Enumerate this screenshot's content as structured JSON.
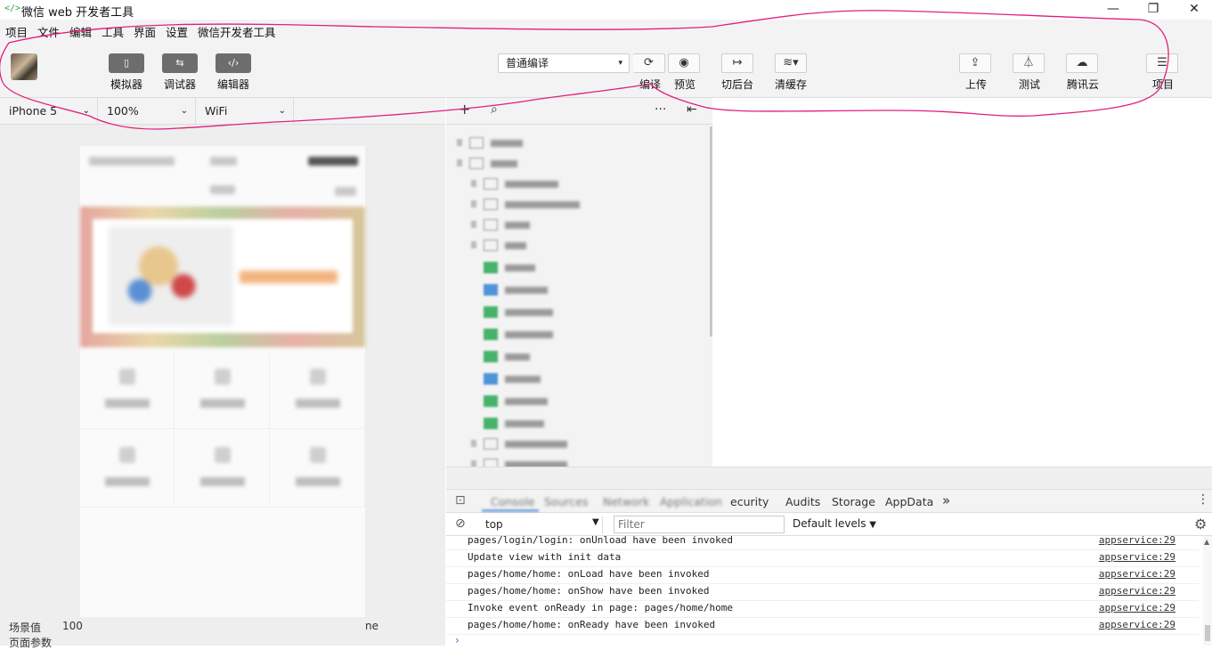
{
  "window": {
    "title": "微信 web 开发者工具",
    "icon": "code-brackets-icon",
    "minimize": "—",
    "maximize": "❐",
    "close": "✕"
  },
  "menubar": {
    "items": [
      "项目",
      "文件",
      "编辑",
      "工具",
      "界面",
      "设置",
      "微信开发者工具"
    ]
  },
  "toolbar": {
    "modes": [
      {
        "label": "模拟器",
        "icon": "phone-icon"
      },
      {
        "label": "调试器",
        "icon": "sliders-icon"
      },
      {
        "label": "编辑器",
        "icon": "code-icon"
      }
    ],
    "compile_select": "普通编译",
    "actions": [
      {
        "label": "编译",
        "icon": "refresh-icon"
      },
      {
        "label": "预览",
        "icon": "eye-icon"
      },
      {
        "label": "切后台",
        "icon": "switch-icon"
      },
      {
        "label": "清缓存",
        "icon": "layers-icon"
      }
    ],
    "right_actions": [
      {
        "label": "上传",
        "icon": "upload-icon"
      },
      {
        "label": "测试",
        "icon": "flask-icon"
      },
      {
        "label": "腾讯云",
        "icon": "cloud-icon"
      },
      {
        "label": "项目",
        "icon": "menu-icon"
      }
    ]
  },
  "devicebar": {
    "device": "iPhone 5",
    "zoom": "100%",
    "network": "WiFi"
  },
  "scene": {
    "label": "场景值",
    "value": "100",
    "params_label": "页面参数",
    "tail": "ne"
  },
  "treebar": {
    "add": "+",
    "search": "⌕",
    "more": "···",
    "collapse": "⇤"
  },
  "devtools": {
    "tabs_visible": [
      "ecurity",
      "Audits",
      "Storage",
      "AppData"
    ],
    "more": "»",
    "context": "top",
    "filter_placeholder": "Filter",
    "levels": "Default levels",
    "prompt": "›"
  },
  "console": {
    "rows": [
      {
        "msg": "pages/login/login: onUnload have been invoked",
        "src": "appservice:29"
      },
      {
        "msg": "Update view with init data",
        "src": "appservice:29"
      },
      {
        "msg": "pages/home/home: onLoad have been invoked",
        "src": "appservice:29"
      },
      {
        "msg": "pages/home/home: onShow have been invoked",
        "src": "appservice:29"
      },
      {
        "msg": "Invoke event onReady in page: pages/home/home",
        "src": "appservice:29"
      },
      {
        "msg": "pages/home/home: onReady have been invoked",
        "src": "appservice:29"
      }
    ]
  },
  "colors": {
    "annotation": "#e0207a",
    "accent_green": "#48b26a",
    "accent_blue": "#4f93d8"
  }
}
